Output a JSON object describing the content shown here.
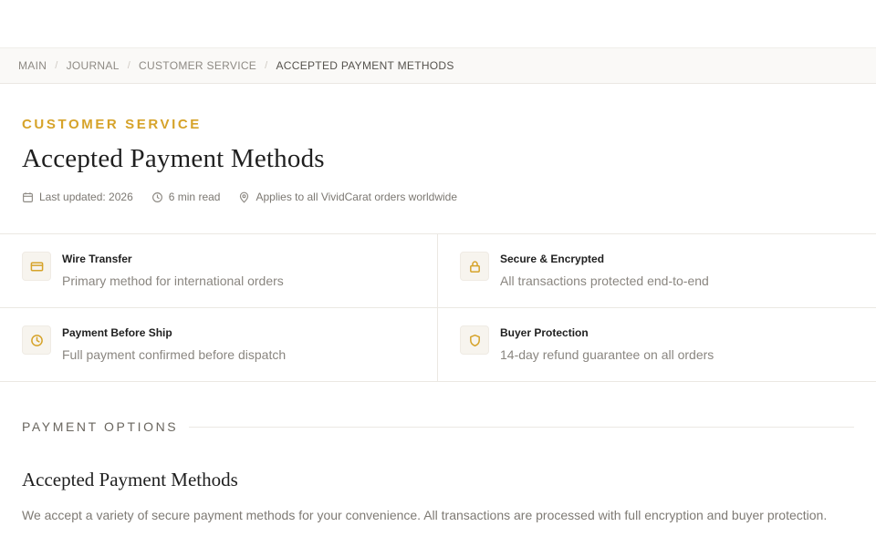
{
  "breadcrumb": {
    "items": [
      "MAIN",
      "JOURNAL",
      "CUSTOMER SERVICE"
    ],
    "current": "ACCEPTED PAYMENT METHODS",
    "separator": "/"
  },
  "hero": {
    "eyebrow": "CUSTOMER SERVICE",
    "title": "Accepted Payment Methods",
    "meta": {
      "updated": "Last updated: 2026",
      "read_time": "6 min read",
      "scope": "Applies to all VividCarat orders worldwide"
    }
  },
  "features": [
    {
      "icon": "credit-card-icon",
      "title": "Wire Transfer",
      "desc": "Primary method for international orders"
    },
    {
      "icon": "lock-icon",
      "title": "Secure & Encrypted",
      "desc": "All transactions protected end-to-end"
    },
    {
      "icon": "clock-icon",
      "title": "Payment Before Ship",
      "desc": "Full payment confirmed before dispatch"
    },
    {
      "icon": "shield-icon",
      "title": "Buyer Protection",
      "desc": "14-day refund guarantee on all orders"
    }
  ],
  "section": {
    "label": "PAYMENT OPTIONS",
    "heading": "Accepted Payment Methods",
    "body": "We accept a variety of secure payment methods for your convenience. All transactions are processed with full encryption and buyer protection."
  },
  "colors": {
    "accent": "#d6a32a",
    "heading": "#1f1f1f",
    "muted": "#8a8680",
    "border": "#ebe8e3"
  }
}
